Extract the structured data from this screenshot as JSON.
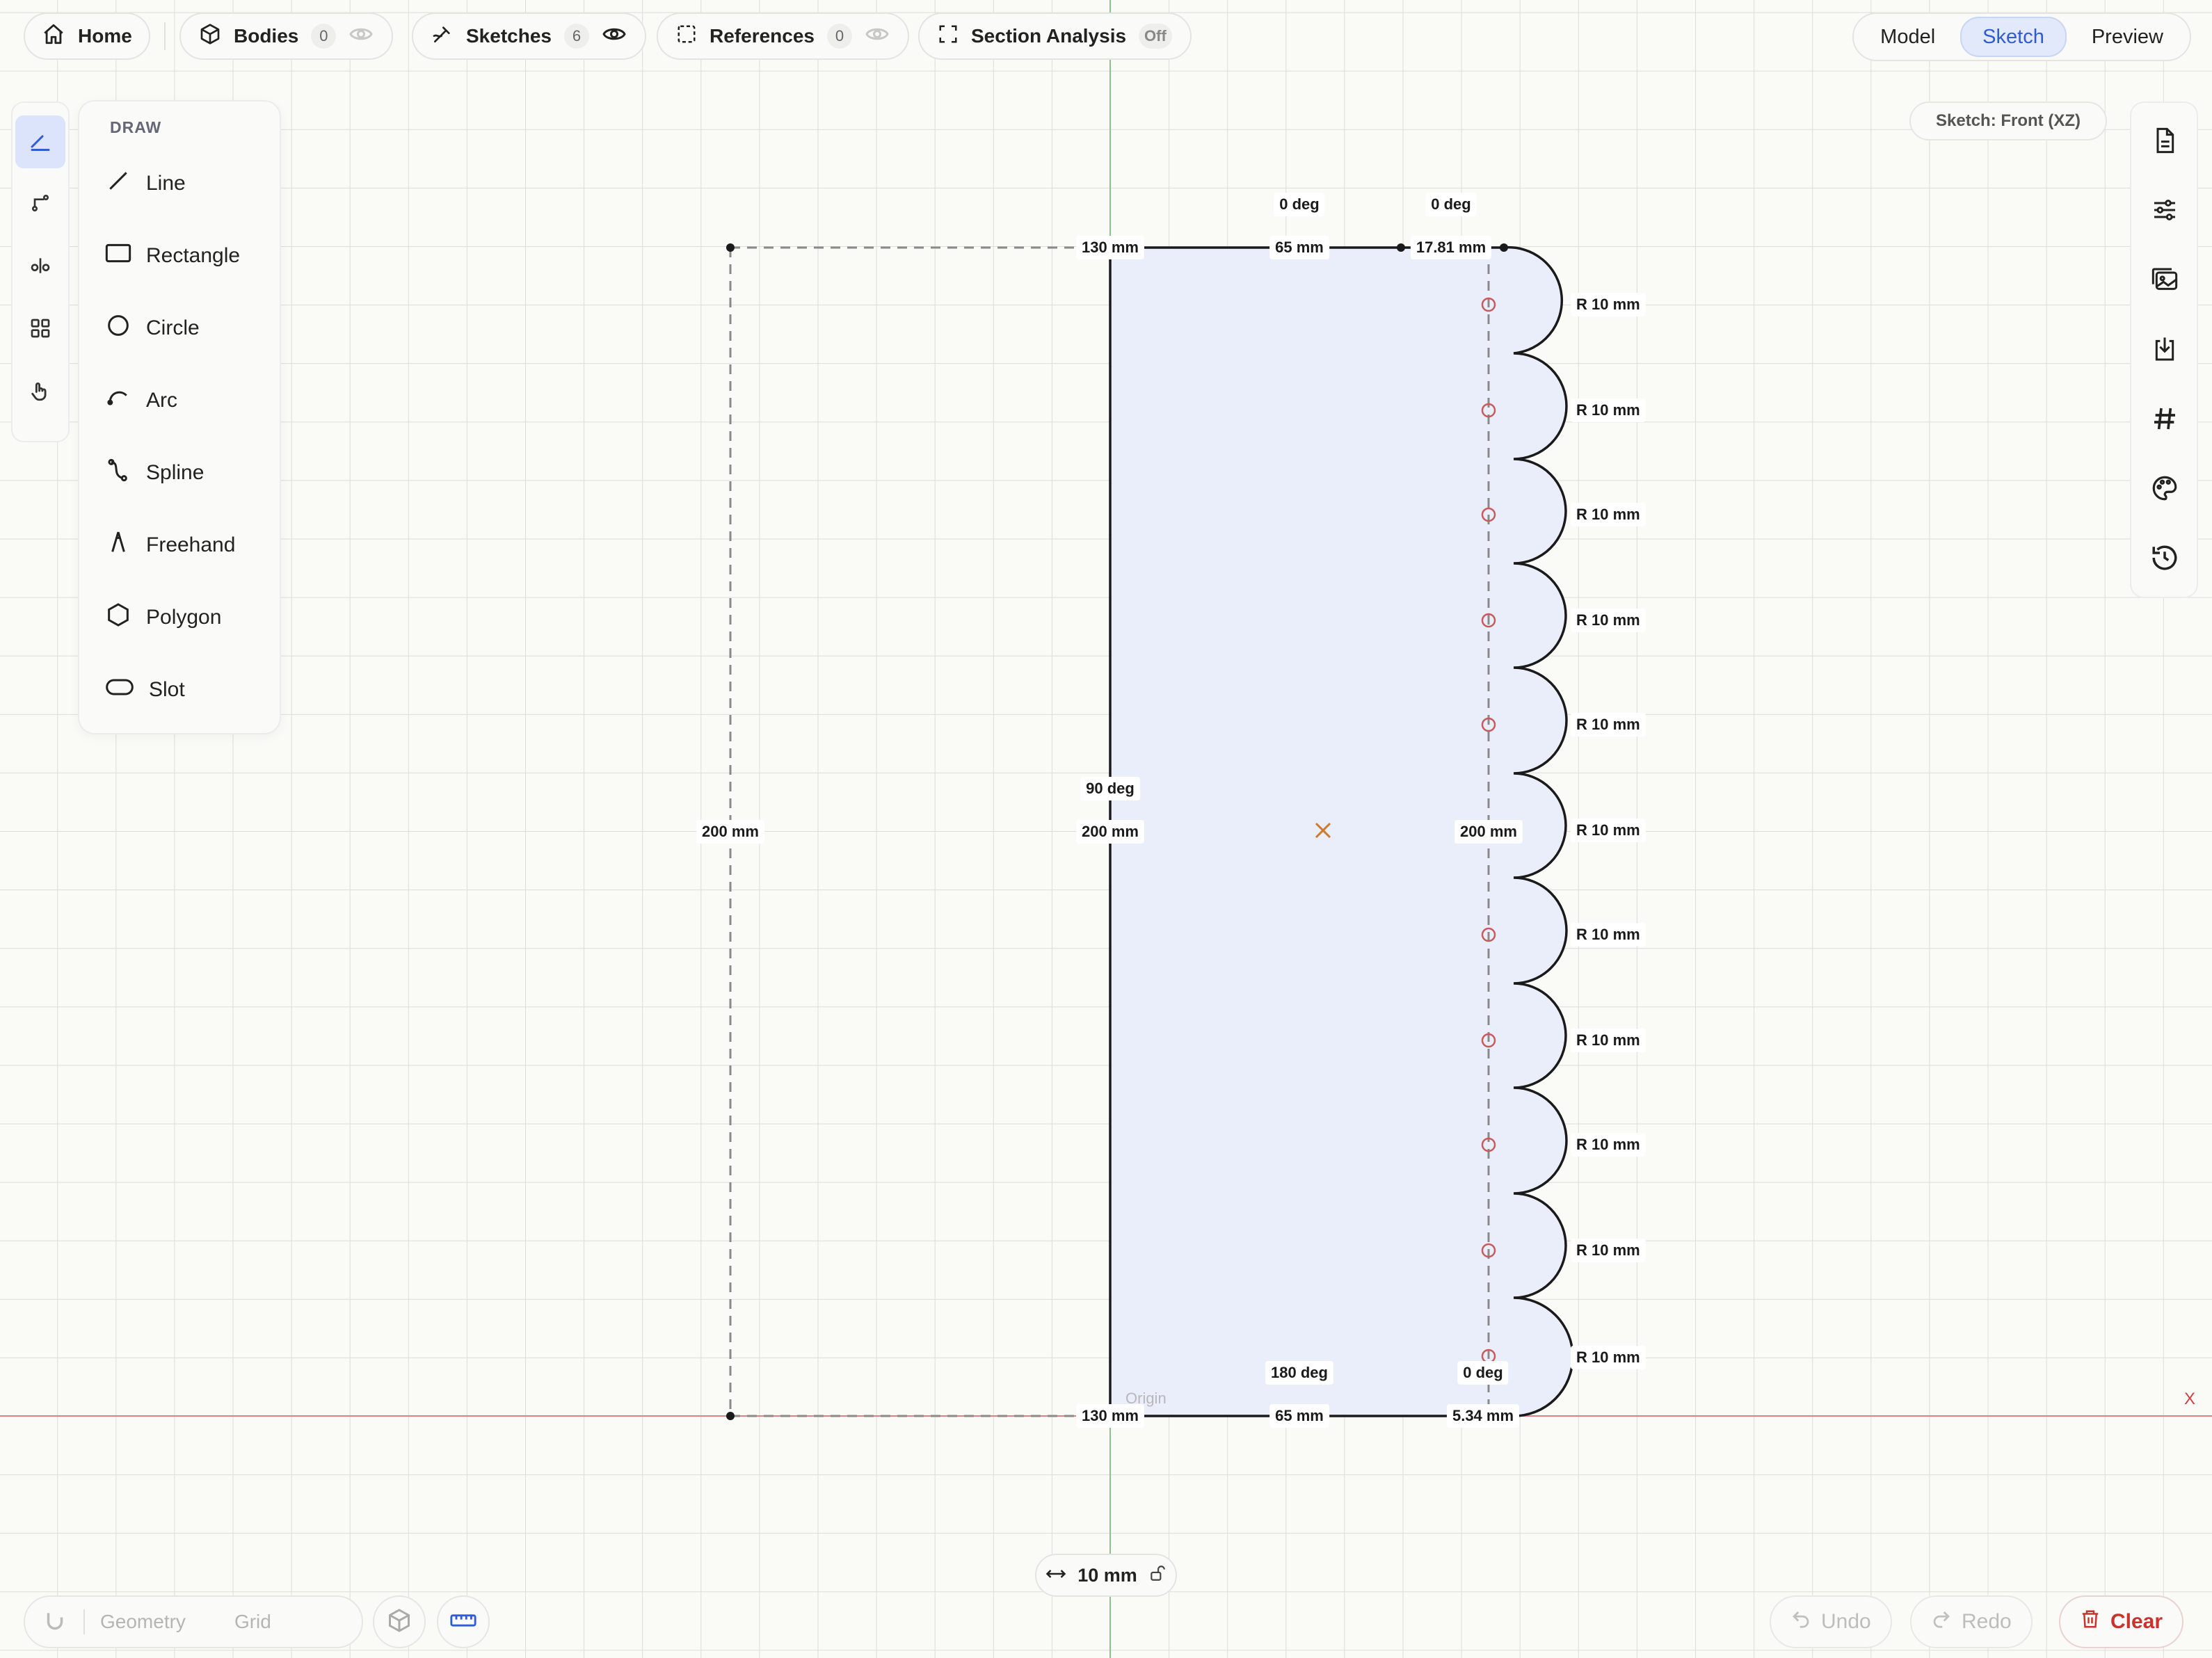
{
  "topbar": {
    "home": {
      "label": "Home",
      "icon": "home-icon"
    },
    "bodies": {
      "label": "Bodies",
      "count": "0",
      "icon": "cube-icon"
    },
    "sketches": {
      "label": "Sketches",
      "count": "6",
      "icon": "pen-icon"
    },
    "references": {
      "label": "References",
      "count": "0",
      "icon": "dashed-square-icon"
    },
    "section": {
      "label": "Section Analysis",
      "state": "Off",
      "icon": "section-frame-icon"
    }
  },
  "modes": {
    "model": "Model",
    "sketch": "Sketch",
    "preview": "Preview",
    "active": "Sketch"
  },
  "sketch_plane": "Sketch: Front (XZ)",
  "draw_menu": {
    "title": "DRAW",
    "items": [
      {
        "label": "Line",
        "icon": "line-icon"
      },
      {
        "label": "Rectangle",
        "icon": "rectangle-icon"
      },
      {
        "label": "Circle",
        "icon": "circle-icon"
      },
      {
        "label": "Arc",
        "icon": "arc-icon"
      },
      {
        "label": "Spline",
        "icon": "spline-icon"
      },
      {
        "label": "Freehand",
        "icon": "freehand-icon"
      },
      {
        "label": "Polygon",
        "icon": "polygon-icon"
      },
      {
        "label": "Slot",
        "icon": "slot-icon"
      }
    ]
  },
  "left_tools": [
    "draw-tool-icon",
    "constraint-tool-icon",
    "mirror-tool-icon",
    "pattern-tool-icon",
    "select-hand-icon"
  ],
  "right_tools": [
    "document-icon",
    "sliders-icon",
    "image-icon",
    "import-icon",
    "hash-icon",
    "palette-icon",
    "history-icon"
  ],
  "dimensions": {
    "top_130": "130 mm",
    "top_65": "65 mm",
    "top_1781": "17.81 mm",
    "top_0deg_a": "0 deg",
    "top_0deg_b": "0 deg",
    "left_200": "200 mm",
    "mid_200": "200 mm",
    "right_200": "200 mm",
    "deg_90": "90 deg",
    "bot_130": "130 mm",
    "bot_65": "65 mm",
    "bot_534": "5.34 mm",
    "bot_180deg": "180 deg",
    "bot_0deg": "0 deg",
    "radius": "R 10 mm"
  },
  "origin_label": "Origin",
  "x_axis_label": "X",
  "grid_step": {
    "value": "10 mm",
    "icons": [
      "width-arrows-icon",
      "unlock-icon"
    ]
  },
  "bottom_left": {
    "geometry": "Geometry",
    "grid": "Grid"
  },
  "history": {
    "undo": "Undo",
    "redo": "Redo",
    "clear": "Clear"
  },
  "colors": {
    "accent": "#2f5bd3",
    "sketch_fill": "#e8eefb",
    "x_axis": "#e07070",
    "z_axis": "#7fb77f",
    "danger": "#c9332c",
    "grid": "#d9d9d6"
  }
}
